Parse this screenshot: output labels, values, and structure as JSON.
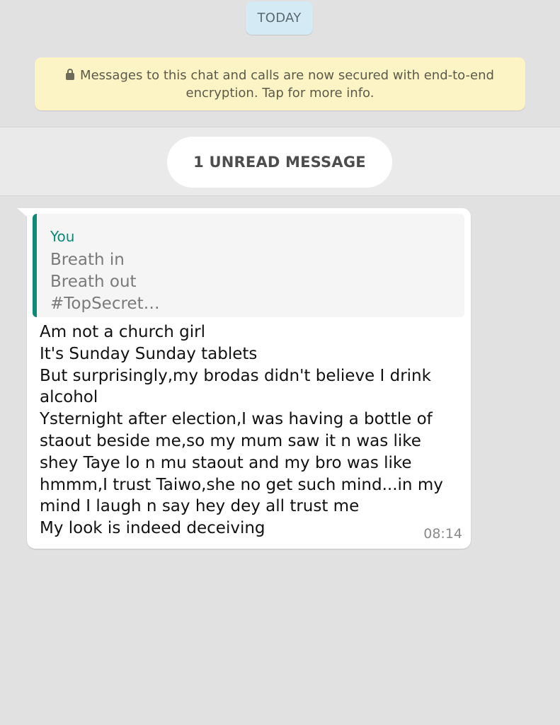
{
  "date_chip": "TODAY",
  "encryption_notice": {
    "line1": "Messages to this chat and calls are now secured with end-to-end",
    "line2": "encryption. Tap for more info."
  },
  "unread_banner": "1 UNREAD MESSAGE",
  "message": {
    "quoted": {
      "author": "You",
      "text": "Breath in\nBreath out\n#TopSecret…"
    },
    "lines": [
      "Am not a church girl",
      "It's Sunday Sunday tablets",
      "But surprisingly,my brodas didn't believe I drink",
      "alcohol",
      "Ysternight after election,I was having a bottle of",
      "staout beside me,so my mum saw it n was like",
      "shey Taye lo n mu staout and my bro was like",
      "hmmm,I trust Taiwo,she no get such mind...in my",
      "mind I laugh n say hey dey all trust me",
      "My look is indeed deceiving"
    ],
    "time": "08:14"
  },
  "colors": {
    "chat_background": "#e1e1e1",
    "date_chip": "#d4eaf4",
    "notice_background": "#fdf4c5",
    "quote_accent": "#0c8a77",
    "bubble": "#ffffff"
  }
}
